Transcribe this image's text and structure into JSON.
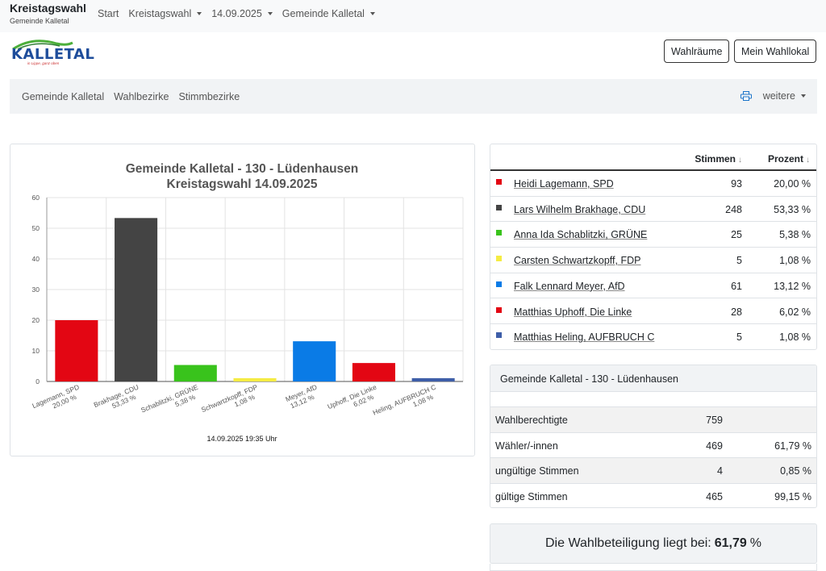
{
  "brand": {
    "title": "Kreistagswahl",
    "subtitle": "Gemeinde Kalletal"
  },
  "nav": {
    "start": "Start",
    "election": "Kreistagswahl",
    "date": "14.09.2025",
    "area": "Gemeinde Kalletal"
  },
  "logo": {
    "text": "KALLETAL",
    "slogan": "in Lippe, ganz oben"
  },
  "buttons": {
    "rooms": "Wahlräume",
    "my_station": "Mein Wahllokal"
  },
  "subnav": {
    "items": [
      "Gemeinde Kalletal",
      "Wahlbezirke",
      "Stimmbezirke"
    ],
    "more": "weitere"
  },
  "chart_data": {
    "type": "bar",
    "title": "Gemeinde Kalletal - 130 - Lüdenhausen",
    "subtitle": "Kreistagswahl 14.09.2025",
    "categories": [
      "Lagemann, SPD",
      "Brakhage, CDU",
      "Schablitzki, GRÜNE",
      "Schwartzkopff, FDP",
      "Meyer, AfD",
      "Uphoff, Die Linke",
      "Heling, AUFBRUCH C"
    ],
    "value_labels": [
      "20,00 %",
      "53,33 %",
      "5,38 %",
      "1,08 %",
      "13,12 %",
      "6,02 %",
      "1,08 %"
    ],
    "values": [
      20.0,
      53.33,
      5.38,
      1.08,
      13.12,
      6.02,
      1.08
    ],
    "colors": [
      "#e30613",
      "#444444",
      "#39c31c",
      "#f5ec43",
      "#0a7be6",
      "#e30613",
      "#3e5ea8"
    ],
    "yticks": [
      "0",
      "10",
      "20",
      "30",
      "40",
      "50",
      "60"
    ],
    "ylim": [
      0,
      60
    ],
    "grid": true,
    "timestamp": "14.09.2025 19:35 Uhr"
  },
  "results": {
    "header": {
      "votes": "Stimmen",
      "percent": "Prozent",
      "sort": "↓"
    },
    "rows": [
      {
        "name": "Heidi Lagemann, SPD",
        "votes": "93",
        "pct": "20,00 %",
        "color": "#e30613"
      },
      {
        "name": "Lars Wilhelm Brakhage, CDU",
        "votes": "248",
        "pct": "53,33 %",
        "color": "#444444"
      },
      {
        "name": "Anna Ida Schablitzki, GRÜNE",
        "votes": "25",
        "pct": "5,38 %",
        "color": "#39c31c"
      },
      {
        "name": "Carsten Schwartzkopff, FDP",
        "votes": "5",
        "pct": "1,08 %",
        "color": "#f5ec43"
      },
      {
        "name": "Falk Lennard Meyer, AfD",
        "votes": "61",
        "pct": "13,12 %",
        "color": "#0a7be6"
      },
      {
        "name": "Matthias Uphoff, Die Linke",
        "votes": "28",
        "pct": "6,02 %",
        "color": "#e30613"
      },
      {
        "name": "Matthias Heling, AUFBRUCH C",
        "votes": "5",
        "pct": "1,08 %",
        "color": "#3e5ea8"
      }
    ]
  },
  "stats": {
    "title": "Gemeinde Kalletal - 130 - Lüdenhausen",
    "rows": [
      {
        "label": "Wahlberechtigte",
        "value": "759",
        "pct": ""
      },
      {
        "label": "Wähler/-innen",
        "value": "469",
        "pct": "61,79 %"
      },
      {
        "label": "ungültige Stimmen",
        "value": "4",
        "pct": "0,85 %"
      },
      {
        "label": "gültige Stimmen",
        "value": "465",
        "pct": "99,15 %"
      }
    ]
  },
  "turnout": {
    "prefix": "Die Wahlbeteiligung liegt bei:",
    "value": "61,79",
    "unit": "%"
  }
}
